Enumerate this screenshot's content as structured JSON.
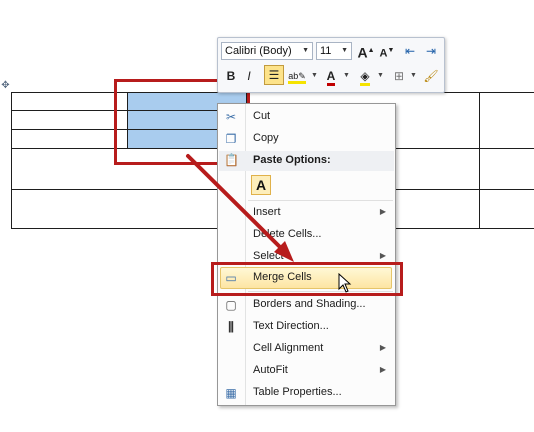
{
  "mini_toolbar": {
    "font_name": "Calibri (Body)",
    "font_size": "11",
    "grow_font_label": "A",
    "shrink_font_label": "A",
    "bold_label": "B",
    "italic_label": "I",
    "font_color_label": "A"
  },
  "context_menu": {
    "items": [
      {
        "label": "Cut",
        "icon": "scissors-icon"
      },
      {
        "label": "Copy",
        "icon": "copy-icon"
      },
      {
        "label": "Paste Options:",
        "icon": "clipboard-icon"
      },
      {
        "label": "A",
        "icon": "paste-keep-text-icon"
      },
      {
        "label": "Insert",
        "has_submenu": true
      },
      {
        "label": "Delete Cells..."
      },
      {
        "label": "Select",
        "has_submenu": true
      },
      {
        "label": "Merge Cells",
        "icon": "merge-cells-icon",
        "highlighted": true
      },
      {
        "label": "Borders and Shading...",
        "icon": "borders-icon"
      },
      {
        "label": "Text Direction...",
        "icon": "text-direction-icon"
      },
      {
        "label": "Cell Alignment",
        "has_submenu": true
      },
      {
        "label": "AutoFit",
        "has_submenu": true
      },
      {
        "label": "Table Properties...",
        "icon": "table-properties-icon"
      }
    ]
  },
  "colors": {
    "annotation_red": "#b71c1c",
    "selection_blue": "#a9ccee",
    "hover_yellow": "#fde5a3"
  }
}
